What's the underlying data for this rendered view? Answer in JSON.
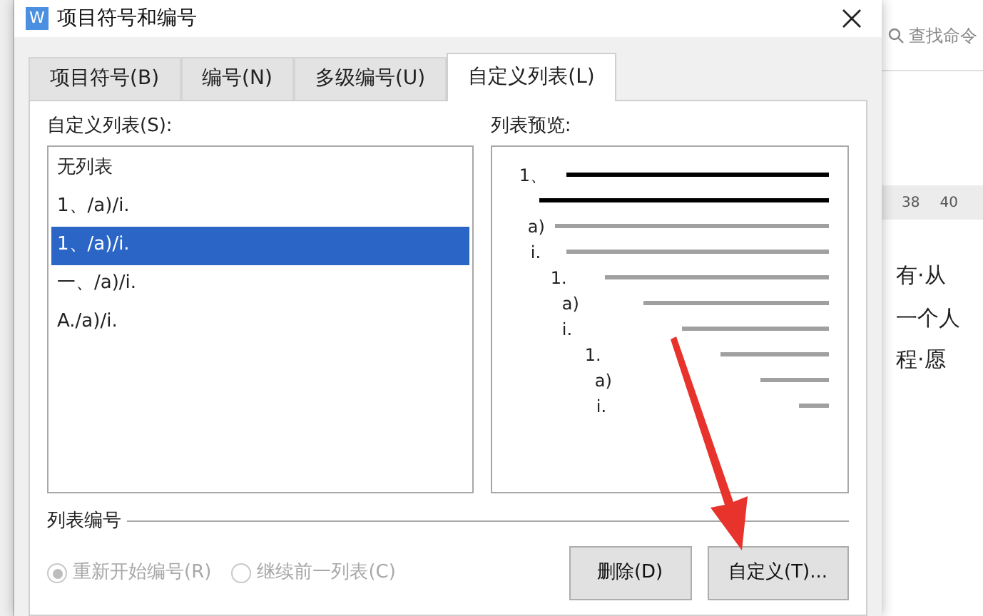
{
  "background": {
    "search_placeholder": "查找命令",
    "ruler": [
      "38",
      "40"
    ],
    "text_lines": [
      "有·从",
      "一个人",
      "程·愿"
    ]
  },
  "window": {
    "title": "项目符号和编号",
    "icon_letter": "W"
  },
  "tabs": [
    {
      "label": "项目符号(B)",
      "selected": false
    },
    {
      "label": "编号(N)",
      "selected": false
    },
    {
      "label": "多级编号(U)",
      "selected": false
    },
    {
      "label": "自定义列表(L)",
      "selected": true
    }
  ],
  "custom_list": {
    "label": "自定义列表(S):",
    "items": [
      {
        "label": "无列表",
        "selected": false
      },
      {
        "label": "1、/a)/i.",
        "selected": false
      },
      {
        "label": "1、/a)/i.",
        "selected": true
      },
      {
        "label": "一、/a)/i.",
        "selected": false
      },
      {
        "label": "A./a)/i.",
        "selected": false
      }
    ]
  },
  "preview": {
    "label": "列表预览:",
    "rows": [
      {
        "label": "1、",
        "kind": "bold"
      },
      {
        "kind": "bold"
      },
      {
        "label": "a)",
        "kind": "plain"
      },
      {
        "label": "i.",
        "kind": "plain"
      },
      {
        "label": "1.",
        "kind": "plain"
      },
      {
        "label": "a)",
        "kind": "plain"
      },
      {
        "label": "i.",
        "kind": "plain"
      },
      {
        "label": "1.",
        "kind": "plain"
      },
      {
        "label": "a)",
        "kind": "plain"
      },
      {
        "label": "i.",
        "kind": "plain"
      }
    ]
  },
  "numbering": {
    "label": "列表编号",
    "options": [
      {
        "label": "重新开始编号(R)",
        "selected": true,
        "disabled": true
      },
      {
        "label": "继续前一列表(C)",
        "selected": false,
        "disabled": true
      }
    ]
  },
  "buttons": [
    "删除(D)",
    "自定义(T)..."
  ]
}
